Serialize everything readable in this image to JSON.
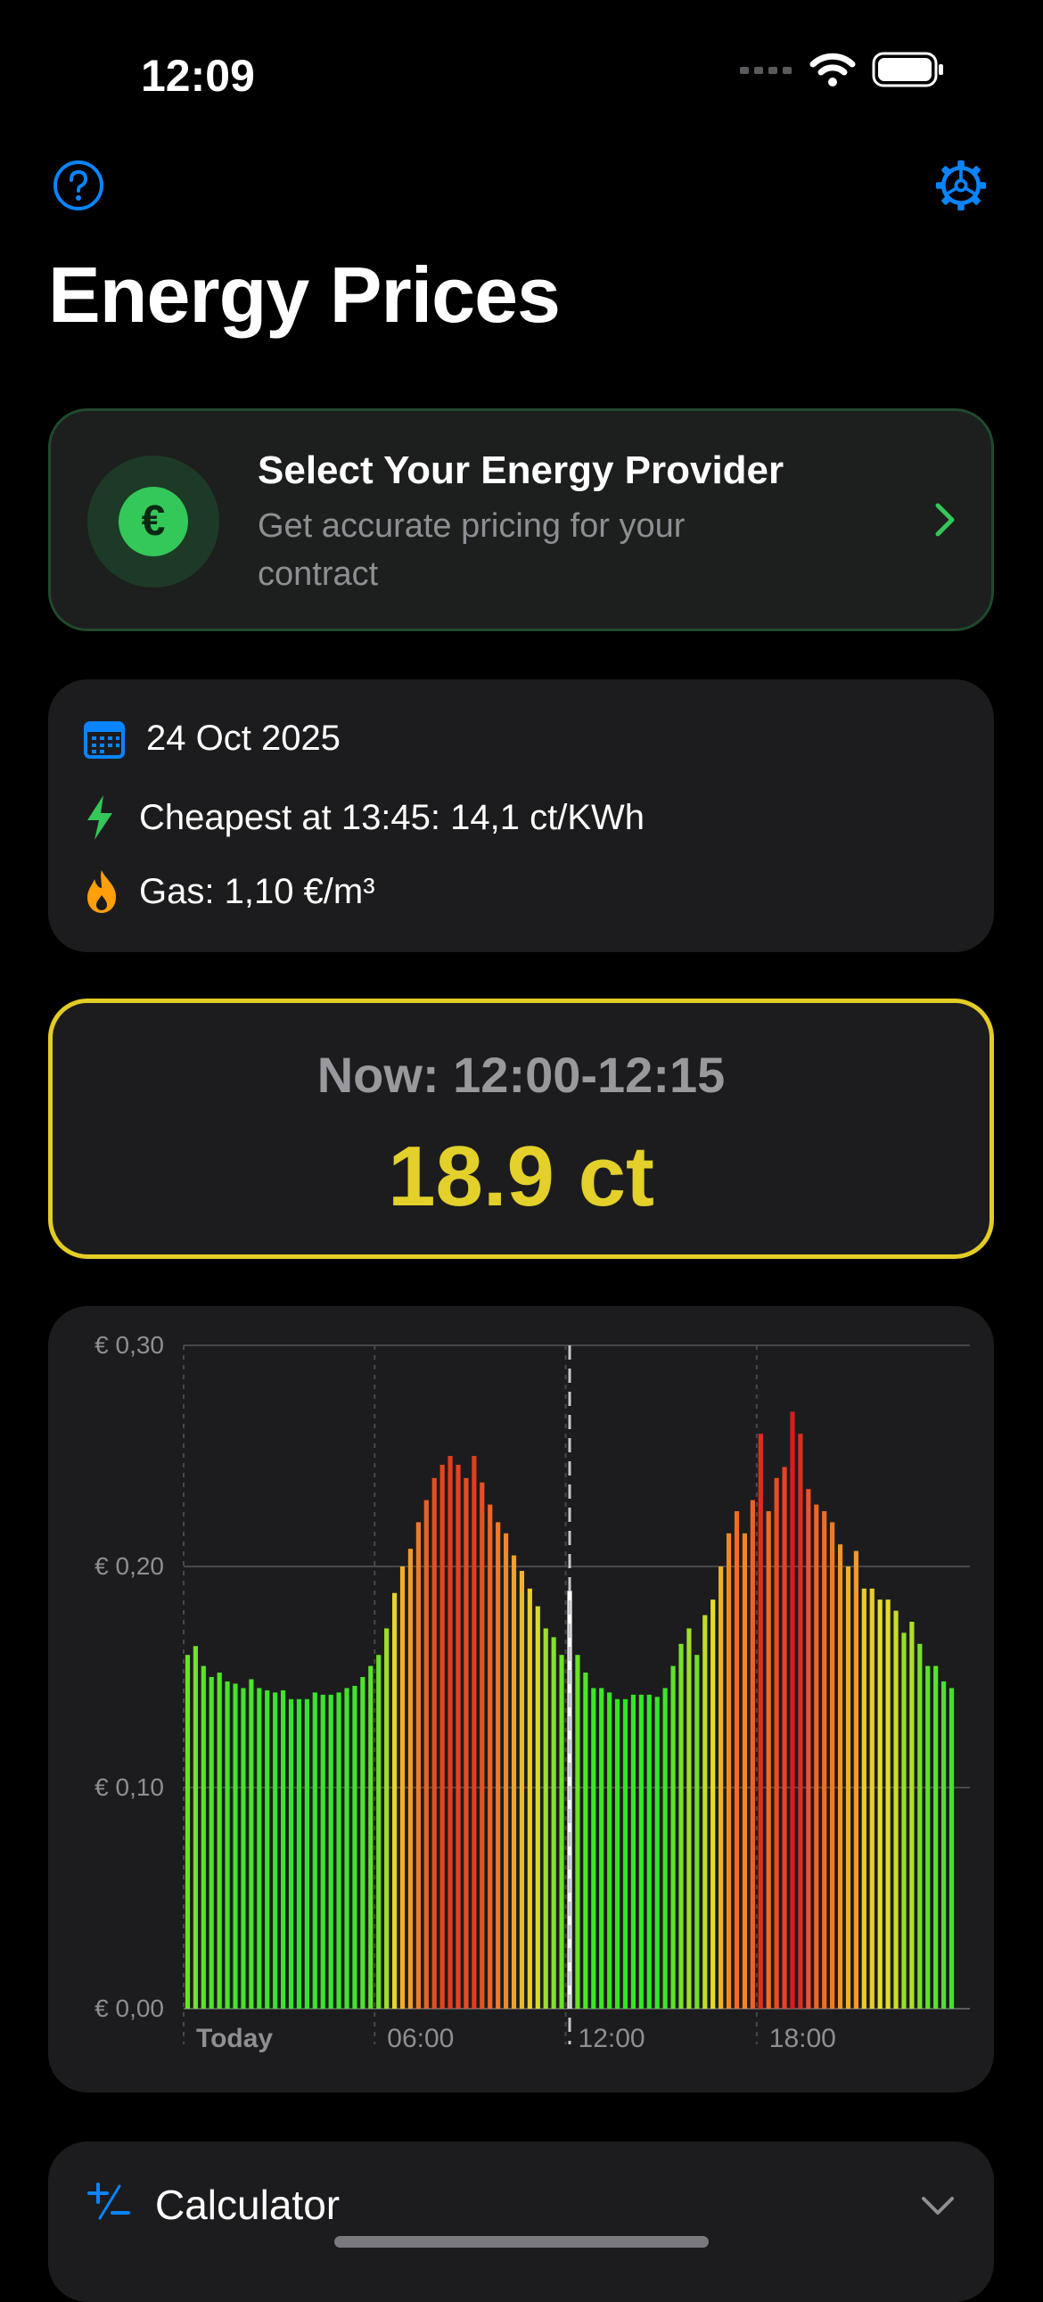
{
  "status_bar": {
    "time": "12:09"
  },
  "header": {
    "title": "Energy Prices",
    "help_icon": "question-circle-icon",
    "settings_icon": "gear-icon"
  },
  "provider_card": {
    "title": "Select Your Energy Provider",
    "subtitle": "Get accurate pricing for your contract",
    "icon": "euro-icon"
  },
  "info": {
    "date": "24 Oct 2025",
    "cheapest": "Cheapest at 13:45: 14,1 ct/KWh",
    "gas": "Gas: 1,10 €/m³"
  },
  "now": {
    "label": "Now: 12:00-12:15",
    "price": "18.9 ct"
  },
  "calculator": {
    "label": "Calculator"
  },
  "colors": {
    "accent_blue": "#0a84ff",
    "green": "#34c759",
    "yellow": "#e3d02a",
    "orange": "#ff9f0a"
  },
  "chart_data": {
    "type": "bar",
    "y_tick_labels": [
      "€ 0,00",
      "€ 0,10",
      "€ 0,20",
      "€ 0,30"
    ],
    "y_ticks": [
      0,
      0.1,
      0.2,
      0.3
    ],
    "ylim": [
      0,
      0.3
    ],
    "x_tick_labels": [
      "Today",
      "06:00",
      "12:00",
      "18:00"
    ],
    "x_tick_indices": [
      0,
      24,
      48,
      72
    ],
    "current_index": 48,
    "unit": "€/kWh",
    "values": [
      0.16,
      0.164,
      0.155,
      0.15,
      0.152,
      0.148,
      0.147,
      0.145,
      0.149,
      0.145,
      0.144,
      0.143,
      0.144,
      0.14,
      0.14,
      0.14,
      0.143,
      0.142,
      0.142,
      0.143,
      0.145,
      0.146,
      0.15,
      0.155,
      0.16,
      0.172,
      0.188,
      0.2,
      0.208,
      0.22,
      0.23,
      0.24,
      0.246,
      0.25,
      0.246,
      0.24,
      0.25,
      0.238,
      0.228,
      0.22,
      0.215,
      0.205,
      0.198,
      0.19,
      0.182,
      0.172,
      0.168,
      0.16,
      0.189,
      0.16,
      0.152,
      0.145,
      0.145,
      0.143,
      0.14,
      0.14,
      0.142,
      0.142,
      0.142,
      0.141,
      0.145,
      0.155,
      0.165,
      0.172,
      0.16,
      0.178,
      0.185,
      0.2,
      0.215,
      0.225,
      0.215,
      0.23,
      0.26,
      0.225,
      0.24,
      0.245,
      0.27,
      0.26,
      0.235,
      0.228,
      0.225,
      0.22,
      0.21,
      0.2,
      0.207,
      0.19,
      0.19,
      0.185,
      0.185,
      0.18,
      0.17,
      0.175,
      0.165,
      0.155,
      0.155,
      0.148,
      0.145
    ]
  }
}
